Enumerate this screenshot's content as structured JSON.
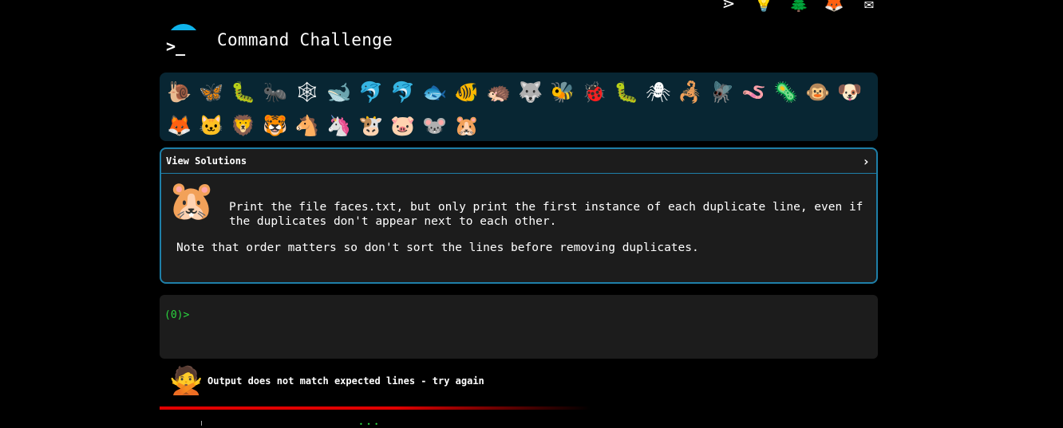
{
  "top_icons": [
    {
      "name": "terminal-icon",
      "glyph": "⋗"
    },
    {
      "name": "idea-icon",
      "glyph": "💡"
    },
    {
      "name": "tree-icon",
      "glyph": "🌲"
    },
    {
      "name": "gitlab-icon",
      "glyph": "🦊"
    },
    {
      "name": "mail-icon",
      "glyph": "✉"
    }
  ],
  "header": {
    "prompt": ">_",
    "title": "Command Challenge"
  },
  "animals": [
    {
      "name": "snail-icon",
      "glyph": "🐌"
    },
    {
      "name": "butterfly-icon",
      "glyph": "🦋"
    },
    {
      "name": "caterpillar-icon",
      "glyph": "🐛"
    },
    {
      "name": "ant-icon",
      "glyph": "🐜"
    },
    {
      "name": "spider-web-icon",
      "glyph": "🕸"
    },
    {
      "name": "whale-icon",
      "glyph": "🐋"
    },
    {
      "name": "dolphin-icon",
      "glyph": "🐬"
    },
    {
      "name": "dolphin-2-icon",
      "glyph": "🐬"
    },
    {
      "name": "fish-icon",
      "glyph": "🐟"
    },
    {
      "name": "tropical-fish-icon",
      "glyph": "🐠"
    },
    {
      "name": "hedgehog-icon",
      "glyph": "🦔"
    },
    {
      "name": "wolf-icon",
      "glyph": "🐺"
    },
    {
      "name": "bee-icon",
      "glyph": "🐝"
    },
    {
      "name": "ladybug-icon",
      "glyph": "🐞"
    },
    {
      "name": "worm-icon",
      "glyph": "🐛"
    },
    {
      "name": "spider-icon",
      "glyph": "🕷"
    },
    {
      "name": "scorpion-icon",
      "glyph": "🦂"
    },
    {
      "name": "fly-icon",
      "glyph": "🪰"
    },
    {
      "name": "worm-2-icon",
      "glyph": "🪱"
    },
    {
      "name": "microbe-icon",
      "glyph": "🦠"
    },
    {
      "name": "monkey-icon",
      "glyph": "🐵"
    },
    {
      "name": "dog-icon",
      "glyph": "🐶"
    },
    {
      "name": "fox-icon",
      "glyph": "🦊"
    },
    {
      "name": "cat-icon",
      "glyph": "🐱"
    },
    {
      "name": "lion-icon",
      "glyph": "🦁"
    },
    {
      "name": "tiger-icon",
      "glyph": "🐯"
    },
    {
      "name": "horse-icon",
      "glyph": "🐴"
    },
    {
      "name": "unicorn-icon",
      "glyph": "🦄"
    },
    {
      "name": "cow-icon",
      "glyph": "🐮"
    },
    {
      "name": "pig-icon",
      "glyph": "🐷"
    },
    {
      "name": "mouse-icon",
      "glyph": "🐭"
    },
    {
      "name": "hamster-icon",
      "glyph": "🐹"
    }
  ],
  "challenge": {
    "view_solutions": "View Solutions",
    "chevron": "›",
    "hamster": "🐹",
    "task": "Print the file faces.txt, but only print the first instance of each duplicate line, even if the duplicates don't appear next to each other.",
    "note": "Note that order matters so don't sort the lines before removing duplicates."
  },
  "terminal": {
    "prompt": "(0)>"
  },
  "result": {
    "face": "🙅",
    "message": "Output does not match expected lines - try again"
  },
  "footer": {
    "dots": "• •  •"
  },
  "colors": {
    "accent": "#1e7fa8",
    "prompt": "#2bd43f",
    "error": "#e00000",
    "panel": "#1c1c1c",
    "iconbar": "#082633"
  }
}
